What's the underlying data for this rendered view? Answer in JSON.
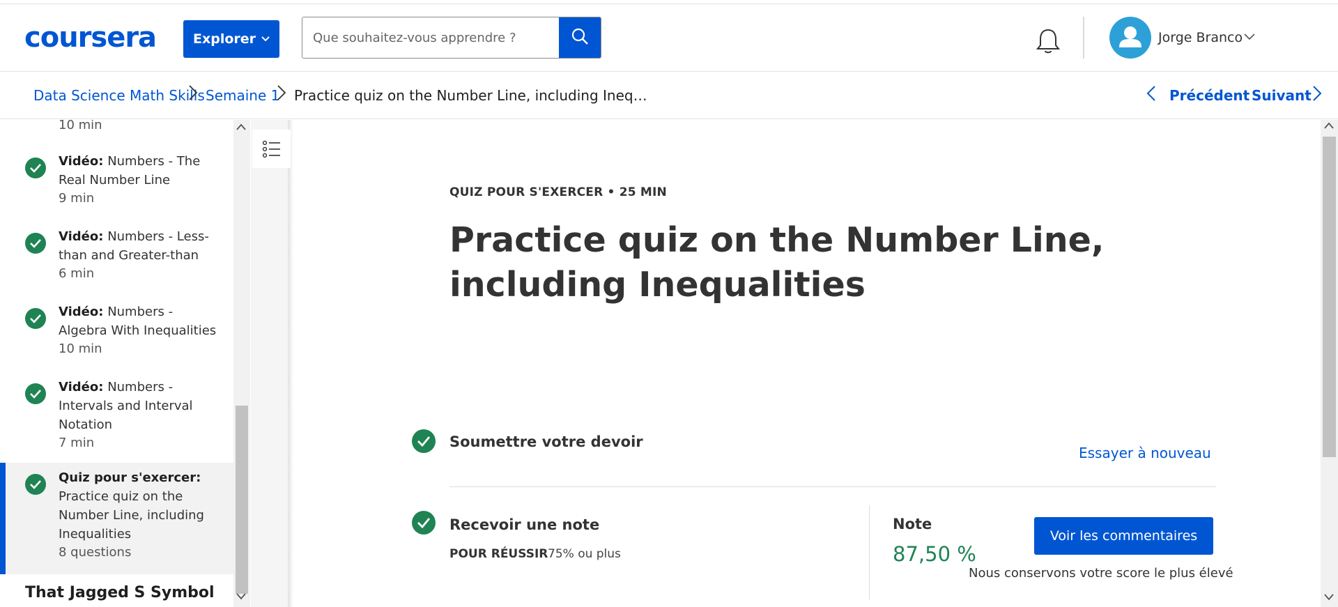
{
  "header": {
    "logo": "coursera",
    "explore_label": "Explorer",
    "search_placeholder": "Que souhaitez-vous apprendre ?",
    "user_name": "Jorge Branco"
  },
  "breadcrumb": {
    "items": [
      "Data Science Math Skills",
      "Semaine 1",
      "Practice quiz on the Number Line, including Ineq…"
    ],
    "prev_label": "Précédent",
    "next_label": "Suivant"
  },
  "sidebar": {
    "top_duration": "10 min",
    "items": [
      {
        "type": "Vidéo:",
        "title": "Numbers - The Real Number Line",
        "line1": "Numbers - The",
        "line2": "Real Number Line",
        "duration": "9 min"
      },
      {
        "type": "Vidéo:",
        "title": "Numbers - Less-than and Greater-than",
        "line1": "Numbers - Less-",
        "line2": "than and Greater-than",
        "duration": "6 min"
      },
      {
        "type": "Vidéo:",
        "title": "Numbers - Algebra With Inequalities",
        "line1": "Numbers -",
        "line2": "Algebra With Inequalities",
        "duration": "10 min"
      },
      {
        "type": "Vidéo:",
        "title": "Numbers - Intervals and Interval Notation",
        "line1": "Numbers -",
        "line2": "Intervals and Interval",
        "line3": "Notation",
        "duration": "7 min"
      }
    ],
    "active": {
      "type": "Quiz pour s'exercer:",
      "line1": "Practice quiz on the",
      "line2": "Number Line, including",
      "line3": "Inequalities",
      "duration": "8 questions"
    },
    "next_section": "That Jagged S Symbol"
  },
  "main": {
    "kicker": "QUIZ POUR S'EXERCER • 25 MIN",
    "title": "Practice quiz on the Number Line, including Inequalities",
    "step1_label": "Soumettre votre devoir",
    "retry_label": "Essayer à nouveau",
    "step2_label": "Recevoir une note",
    "pass_label": "POUR RÉUSSIR",
    "pass_value": "75% ou plus",
    "grade_label": "Note",
    "grade_value": "87,50 %",
    "feedback_label": "Voir les commentaires",
    "keep_note": "Nous conservons votre score le plus élevé"
  },
  "colors": {
    "brand": "#0056d2",
    "success": "#1f8354"
  },
  "icons": [
    "chevron-down-icon",
    "search-icon",
    "bell-icon",
    "user-avatar-icon",
    "chevron-right-icon",
    "chevron-left-icon",
    "check-circle-icon",
    "list-outline-icon",
    "scroll-up-icon",
    "scroll-down-icon"
  ]
}
